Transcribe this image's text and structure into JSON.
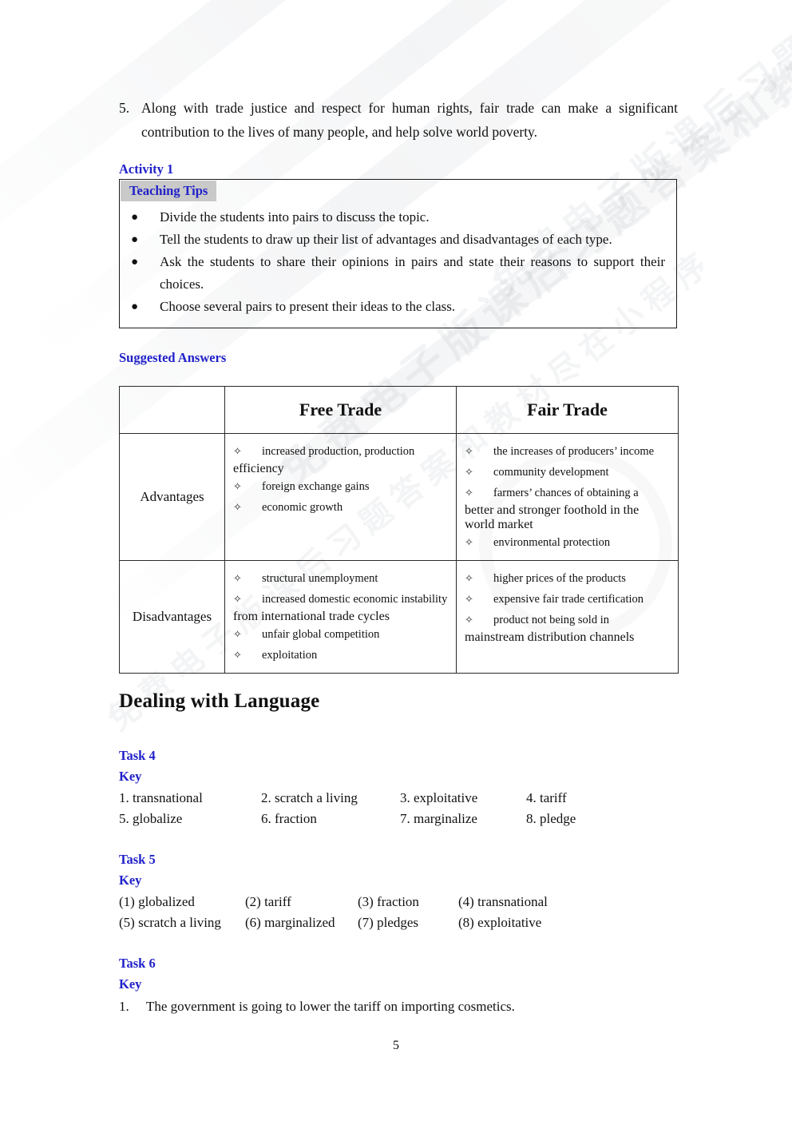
{
  "paragraph_5": {
    "number": "5.",
    "line1": "Along with trade justice and respect for human rights, fair trade can make a significant",
    "line2": "contribution to the lives of many people, and help solve world poverty."
  },
  "activity": {
    "heading": "Activity 1",
    "tips_badge": "Teaching Tips",
    "tips": [
      {
        "bullet": "●",
        "line1": "Divide the students into pairs to discuss the topic.",
        "line2": ""
      },
      {
        "bullet": "●",
        "line1": "Tell the students to draw up their list of advantages and disadvantages of each type.",
        "line2": ""
      },
      {
        "bullet": "●",
        "line1": "Ask the students to share their opinions in pairs and state their reasons to support their",
        "line2": "choices."
      },
      {
        "bullet": "●",
        "line1": "Choose several pairs to present their ideas to the class.",
        "line2": ""
      }
    ]
  },
  "suggested_answers": {
    "heading": "Suggested Answers",
    "table": {
      "corner": "",
      "col_headers": [
        "Free Trade",
        "Fair Trade"
      ],
      "rows": [
        {
          "label": "Advantages",
          "free": [
            {
              "marker": "✧",
              "text": "increased production, production",
              "cont": "efficiency"
            },
            {
              "marker": "✧",
              "text": "foreign exchange gains",
              "cont": ""
            },
            {
              "marker": "✧",
              "text": "economic growth",
              "cont": ""
            }
          ],
          "fair": [
            {
              "marker": "✧",
              "text": "the increases of producers’ income",
              "cont": ""
            },
            {
              "marker": "✧",
              "text": "community development",
              "cont": ""
            },
            {
              "marker": "✧",
              "text": "farmers’ chances of obtaining a",
              "cont": "better and stronger foothold in the"
            },
            {
              "marker": "",
              "text": "",
              "cont": "world market"
            },
            {
              "marker": "✧",
              "text": "environmental protection",
              "cont": ""
            }
          ]
        },
        {
          "label": "Disadvantages",
          "free": [
            {
              "marker": "✧",
              "text": "structural unemployment",
              "cont": ""
            },
            {
              "marker": "✧",
              "text": "increased domestic economic instability",
              "cont": "from international trade cycles"
            },
            {
              "marker": "✧",
              "text": "unfair global competition",
              "cont": ""
            },
            {
              "marker": "✧",
              "text": "exploitation",
              "cont": ""
            }
          ],
          "fair": [
            {
              "marker": "✧",
              "text": "higher prices of the products",
              "cont": ""
            },
            {
              "marker": "✧",
              "text": "expensive fair trade certification",
              "cont": ""
            },
            {
              "marker": "✧",
              "text": "product not being sold in",
              "cont": "mainstream distribution channels"
            }
          ]
        }
      ]
    }
  },
  "dealing_with_language": {
    "title": "Dealing with Language",
    "task4": {
      "heading": "Task 4",
      "key_label": "Key",
      "answers": [
        [
          "1. transnational",
          "2. scratch a living",
          "3. exploitative",
          "4. tariff"
        ],
        [
          "5. globalize",
          "6. fraction",
          "7. marginalize",
          " 8. pledge"
        ]
      ]
    },
    "task5": {
      "heading": "Task 5",
      "key_label": "Key",
      "answers": [
        [
          "(1) globalized",
          "(2) tariff",
          "(3) fraction",
          "(4) transnational"
        ],
        [
          "(5) scratch a living",
          "(6) marginalized",
          "(7) pledges",
          "(8) exploitative"
        ]
      ]
    },
    "task6": {
      "heading": "Task 6",
      "key_label": "Key",
      "items": [
        {
          "number": "1.",
          "text": "The government is going to lower the tariff on importing cosmetics."
        }
      ]
    }
  },
  "footer": {
    "page_number": "5"
  },
  "colors": {
    "heading_blue": "#2121c9",
    "badge_gray": "#c9c9c9",
    "text_black": "#111111",
    "table_border": "#2a2a2a"
  },
  "watermark": {
    "text": "免费电子版课后习题答案和教材尽在小程序"
  }
}
